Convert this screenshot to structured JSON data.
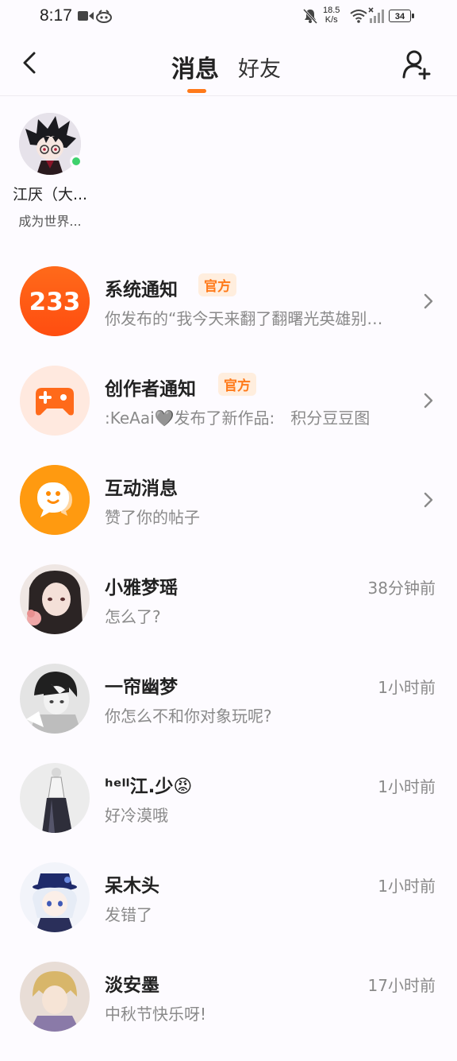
{
  "status_bar": {
    "time": "8:17",
    "net_speed_value": "18.5",
    "net_speed_unit": "K/s",
    "battery": "34"
  },
  "header": {
    "tab_messages": "消息",
    "tab_friends": "好友"
  },
  "friend": {
    "name": "江厌（大...",
    "signature": "成为世界..."
  },
  "rows": [
    {
      "title": "系统通知",
      "badge": "官方",
      "subtitle": "你发布的“我今天来翻了翻曙光英雄别…",
      "icon_text": "233"
    },
    {
      "title": "创作者通知",
      "badge": "官方",
      "subtitle": ":KeAai🩶发布了新作品:　积分豆豆图"
    },
    {
      "title": "互动消息",
      "subtitle": "赞了你的帖子"
    },
    {
      "title": "小雅梦瑶",
      "subtitle": "怎么了?",
      "time": "38分钟前"
    },
    {
      "title": "一帘幽梦",
      "subtitle": "你怎么不和你对象玩呢?",
      "time": "1小时前"
    },
    {
      "title": "ʰᵉˡˡ江.少😡",
      "subtitle": "好冷漠哦",
      "time": "1小时前"
    },
    {
      "title": "呆木头",
      "subtitle": "发错了",
      "time": "1小时前"
    },
    {
      "title": "淡安墨",
      "subtitle": "中秋节快乐呀!",
      "time": "17小时前"
    }
  ],
  "colors": {
    "accent": "#ff7a1a",
    "online": "#3ed16c",
    "system_icon": "#ff5a14",
    "creator_icon_bg": "#ffe9df",
    "interaction_icon": "#ff9a10"
  },
  "icons": [
    "back-arrow-icon",
    "add-friend-icon",
    "chevron-right-icon",
    "gamepad-icon",
    "chat-smile-icon"
  ]
}
